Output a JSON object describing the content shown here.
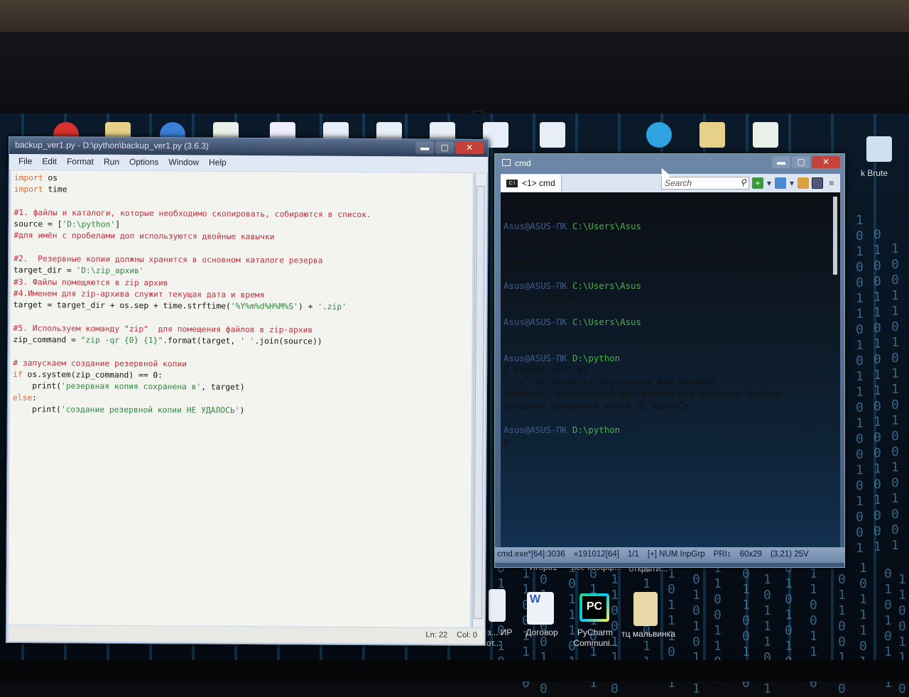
{
  "desktop": {
    "top_icons": [
      "opera-icon",
      "folder-icon",
      "chrome-icon",
      "excel-file-icon",
      "text-file-icon",
      "word-file-icon",
      "word-file-icon",
      "word-file-icon",
      "word-file-icon",
      "word-file-icon",
      "telegram-icon",
      "folder-icon",
      "excel-file-icon",
      "image-file-icon"
    ],
    "right_label": "k Brute",
    "bottom_top_labels": [
      "Игорь1",
      "все коэфф...",
      "открыти..."
    ],
    "bottom_icons": [
      {
        "icon": "excel-file-icon",
        "label": "ор-з... ИР от..."
      },
      {
        "icon": "word-file-icon",
        "label": "Договор"
      },
      {
        "icon": "pycharm-icon",
        "label": "PyCharm Communi...",
        "badge": "PC"
      },
      {
        "icon": "folder-icon",
        "label": "тц мальвинка"
      }
    ]
  },
  "idle": {
    "title": "backup_ver1.py - D:\\python\\backup_ver1.py (3.6.3)",
    "menu": [
      "File",
      "Edit",
      "Format",
      "Run",
      "Options",
      "Window",
      "Help"
    ],
    "code": [
      [
        [
          "kw",
          "import"
        ],
        [
          "nm",
          " os"
        ]
      ],
      [
        [
          "kw",
          "import"
        ],
        [
          "nm",
          " time"
        ]
      ],
      [],
      [
        [
          "cm",
          "#1. файлы и каталоги, которые необходимо скопировать, собираются в список."
        ]
      ],
      [
        [
          "nm",
          "source = ["
        ],
        [
          "st",
          "'D:\\python'"
        ],
        [
          "nm",
          "]"
        ]
      ],
      [
        [
          "cm",
          "#для имён с пробелами доп используются двойные кавычки"
        ]
      ],
      [],
      [
        [
          "cm",
          "#2.  Резервные копии должны хранится в основном каталоге резерва"
        ]
      ],
      [
        [
          "nm",
          "target_dir = "
        ],
        [
          "st",
          "'D:\\zip_архив'"
        ]
      ],
      [
        [
          "cm",
          "#3. Файлы помещяются в zip архив"
        ]
      ],
      [
        [
          "cm",
          "#4.Именем для zip-архива служит текущая дата и время"
        ]
      ],
      [
        [
          "nm",
          "target = target_dir + os.sep + time.strftime("
        ],
        [
          "st",
          "'%Y%m%d%H%M%S'"
        ],
        [
          "nm",
          ") + "
        ],
        [
          "st",
          "'.zip'"
        ]
      ],
      [],
      [
        [
          "cm",
          "#5. Используем команду \"zip\"  для помещения файлов в zip-архив"
        ]
      ],
      [
        [
          "nm",
          "zip_command = "
        ],
        [
          "st",
          "\"zip -qr {0} {1}\""
        ],
        [
          "nm",
          ".format(target, "
        ],
        [
          "st",
          "' '"
        ],
        [
          "nm",
          ".join(source))"
        ]
      ],
      [],
      [
        [
          "cm",
          "# запускаем создание резервной копии"
        ]
      ],
      [
        [
          "kw",
          "if"
        ],
        [
          "nm",
          " os.system(zip_command) == 0:"
        ]
      ],
      [
        [
          "nm",
          "    print("
        ],
        [
          "st",
          "'резервная копия сохранена в'"
        ],
        [
          "nm",
          ", target)"
        ]
      ],
      [
        [
          "kw",
          "else"
        ],
        [
          "nm",
          ":"
        ]
      ],
      [
        [
          "nm",
          "    print("
        ],
        [
          "st",
          "'создание резервной копии НЕ УДАЛОСЬ'"
        ],
        [
          "nm",
          ")"
        ]
      ]
    ],
    "status": {
      "line": "Ln: 22",
      "col": "Col: 0"
    }
  },
  "cmd": {
    "title": "cmd",
    "tab_label": "<1> cmd",
    "tab_icon_text": "C:\\",
    "search_placeholder": "Search",
    "lines": [
      [
        [
          "nm",
          "Microsoft Windows [Version 6.1.7601]"
        ]
      ],
      [],
      [
        [
          "pu",
          "Asus@ASUS-ПК "
        ],
        [
          "pp",
          "C:\\Users\\Asus"
        ]
      ],
      [
        [
          "nm",
          "$ zip_command"
        ]
      ],
      [
        [
          "nm",
          "\"zip_command\" не является внутренней или внешней"
        ]
      ],
      [
        [
          "nm",
          "командой, исполняемой программой или пакетным файлом."
        ]
      ],
      [],
      [
        [
          "pu",
          "Asus@ASUS-ПК "
        ],
        [
          "pp",
          "C:\\Users\\Asus"
        ]
      ],
      [
        [
          "nm",
          "$ cd D:\\python"
        ]
      ],
      [],
      [
        [
          "pu",
          "Asus@ASUS-ПК "
        ],
        [
          "pp",
          "C:\\Users\\Asus"
        ]
      ],
      [
        [
          "nm",
          "$ D:"
        ]
      ],
      [],
      [
        [
          "pu",
          "Asus@ASUS-ПК "
        ],
        [
          "pp",
          "D:\\python"
        ]
      ],
      [
        [
          "nm",
          "$ backup_ver1.py"
        ]
      ],
      [
        [
          "nm",
          "\"zip\" не является внутренней или внешней"
        ]
      ],
      [
        [
          "nm",
          "командой, исполняемой программой или пакетным файлом."
        ]
      ],
      [
        [
          "nm",
          "создание резервной копии НЕ УДАЛОСЬ"
        ]
      ],
      [],
      [
        [
          "pu",
          "Asus@ASUS-ПК "
        ],
        [
          "pp",
          "D:\\python"
        ]
      ],
      [
        [
          "nm",
          "$"
        ]
      ]
    ],
    "status": [
      "cmd.exe*[64]:3036",
      "«191012[64]",
      "1/1",
      "[+] NUM InpGrp",
      "PRI↕",
      "60x29",
      "(3,21) 25V"
    ]
  }
}
